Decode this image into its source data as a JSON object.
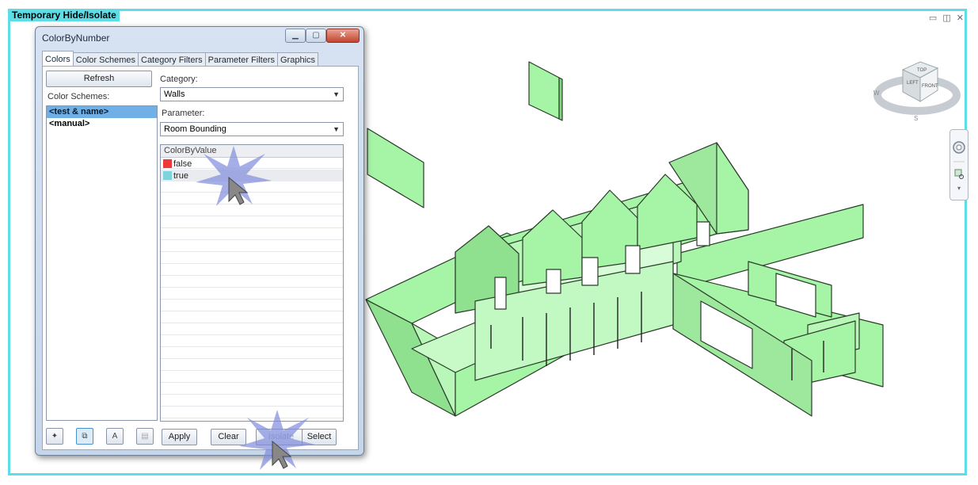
{
  "viewport": {
    "mode_label": "Temporary Hide/Isolate",
    "window_controls": "▭ ◫ ✕",
    "model_color": "#a6f5a6",
    "frame_color": "#5fdde6"
  },
  "dialog": {
    "title": "ColorByNumber",
    "tabs": [
      {
        "label": "Colors",
        "active": true
      },
      {
        "label": "Color Schemes"
      },
      {
        "label": "Category Filters"
      },
      {
        "label": "Parameter Filters"
      },
      {
        "label": "Graphics"
      }
    ],
    "refresh_label": "Refresh",
    "color_schemes_label": "Color Schemes:",
    "schemes": [
      "<test & name>",
      "<manual>"
    ],
    "category_label": "Category:",
    "category_value": "Walls",
    "parameter_label": "Parameter:",
    "parameter_value": "Room Bounding",
    "grid_header": "ColorByValue",
    "values": [
      {
        "label": "false",
        "color": "#f03838"
      },
      {
        "label": "true",
        "color": "#7fd3dc"
      }
    ],
    "buttons": {
      "apply": "Apply",
      "clear": "Clear",
      "isolate": "Isolate",
      "select": "Select"
    }
  },
  "viewcube": {
    "faces": {
      "top": "TOP",
      "left": "LEFT",
      "front": "FRONT"
    },
    "compass": {
      "west": "W",
      "south": "S"
    }
  }
}
